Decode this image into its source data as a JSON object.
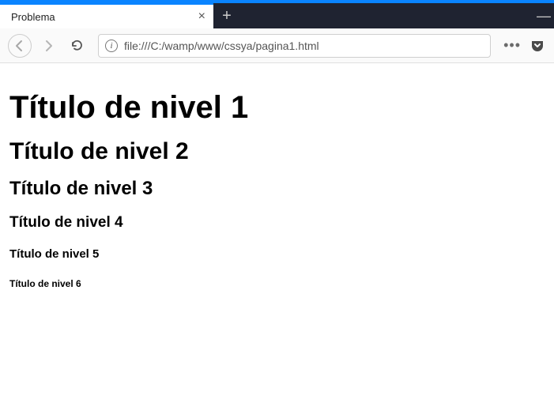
{
  "tab": {
    "title": "Problema"
  },
  "url": "file:///C:/wamp/www/cssya/pagina1.html",
  "headings": {
    "h1": "Título de nivel 1",
    "h2": "Título de nivel 2",
    "h3": "Título de nivel 3",
    "h4": "Título de nivel 4",
    "h5": "Título de nivel 5",
    "h6": "Título de nivel 6"
  }
}
